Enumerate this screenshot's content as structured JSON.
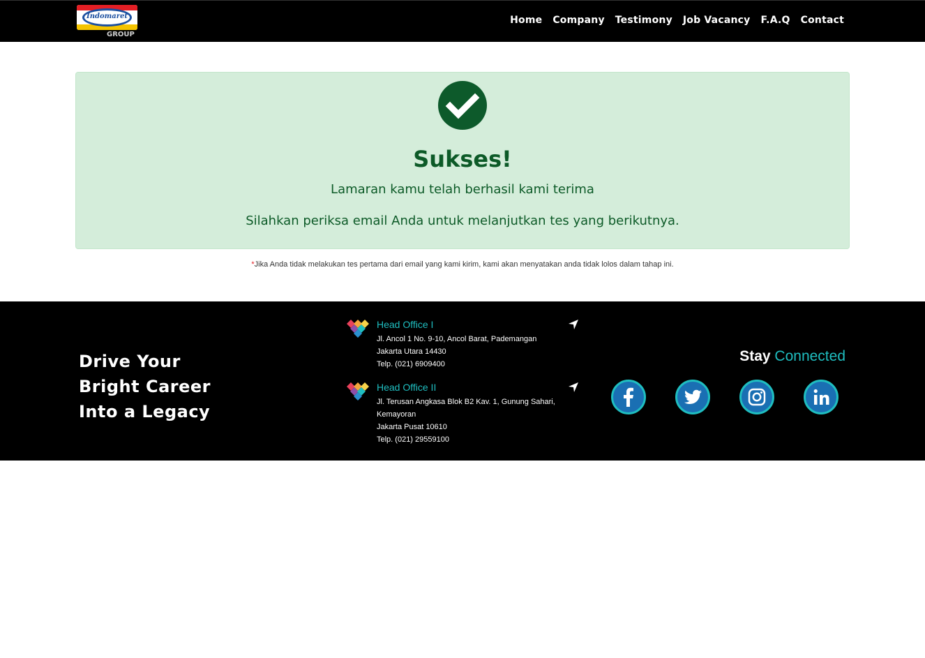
{
  "header": {
    "logo_text": "Indomaret",
    "logo_group": "GROUP",
    "nav": [
      "Home",
      "Company",
      "Testimony",
      "Job Vacancy",
      "F.A.Q",
      "Contact"
    ]
  },
  "alert": {
    "title": "Sukses!",
    "line1": "Lamaran kamu telah berhasil kami terima",
    "line2": "Silahkan periksa email Anda untuk melanjutkan tes yang berikutnya.",
    "icon": "check-circle-icon"
  },
  "note": {
    "star": "*",
    "text": "Jika Anda tidak melakukan tes pertama dari email yang kami kirim, kami akan menyatakan anda tidak lolos dalam tahap ini."
  },
  "footer": {
    "tagline": [
      "Drive Your",
      "Bright Career",
      "Into a Legacy"
    ],
    "offices": [
      {
        "name": "Head Office I",
        "lines": [
          "Jl. Ancol 1 No. 9-10, Ancol Barat, Pademangan",
          "Jakarta Utara 14430",
          "Telp. (021) 6909400"
        ]
      },
      {
        "name": "Head Office II",
        "lines": [
          "Jl. Terusan Angkasa Blok B2 Kav. 1, Gunung Sahari,",
          "Kemayoran",
          "Jakarta Pusat 10610",
          "Telp. (021) 29559100"
        ]
      }
    ],
    "stay": "Stay",
    "connected": "Connected",
    "social": [
      "facebook-icon",
      "twitter-icon",
      "instagram-icon",
      "linkedin-icon"
    ]
  },
  "colors": {
    "accent": "#1fbec0",
    "success_bg": "#d4edda",
    "success_text": "#0c5a27",
    "social_blue": "#1a6fb3"
  }
}
